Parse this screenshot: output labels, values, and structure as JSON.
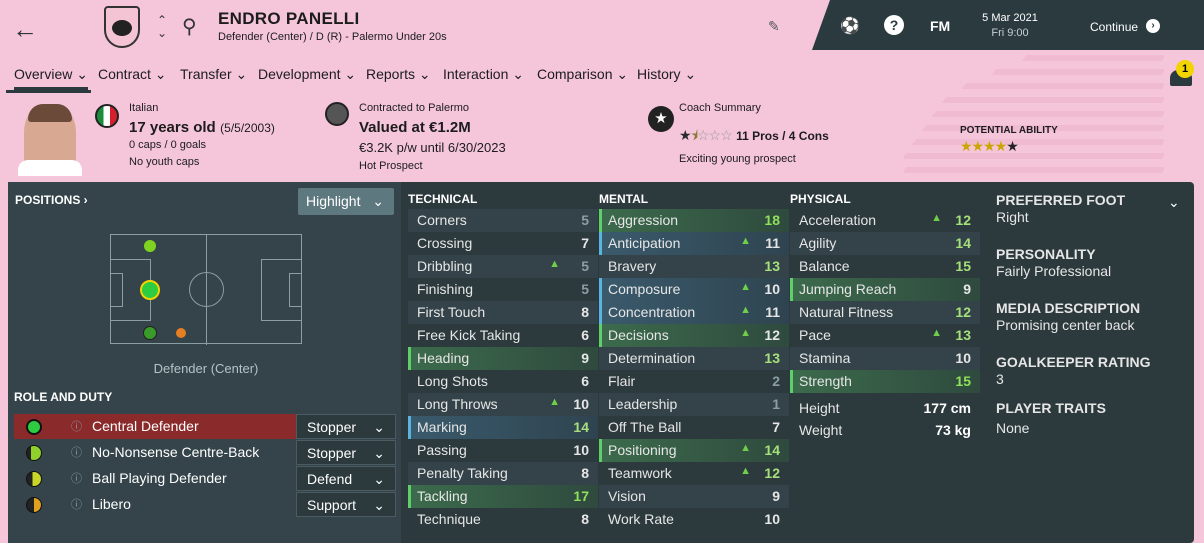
{
  "header": {
    "player_name": "ENDRO PANELLI",
    "player_sub": "Defender (Center) / D (R) - Palermo Under 20s",
    "date": "5 Mar 2021",
    "time": "Fri 9:00",
    "continue_label": "Continue",
    "fm_label": "FM",
    "notification_count": "1"
  },
  "tabs": [
    "Overview",
    "Contract",
    "Transfer",
    "Development",
    "Reports",
    "Interaction",
    "Comparison",
    "History"
  ],
  "bio": {
    "nationality": "Italian",
    "age": "17 years old",
    "dob": "(5/5/2003)",
    "caps": "0 caps / 0 goals",
    "youth_caps": "No youth caps",
    "contracted": "Contracted to Palermo",
    "value": "Valued at €1.2M",
    "wage": "€3.2K p/w until 6/30/2023",
    "status": "Hot Prospect",
    "coach_title": "Coach Summary",
    "pros_cons": "11 Pros / 4 Cons",
    "coach_note": "Exciting young prospect",
    "potential_label": "POTENTIAL ABILITY",
    "current_stars": 1.5,
    "potential_stars": 4.5
  },
  "positions": {
    "label": "POSITIONS",
    "highlight_label": "Highlight",
    "position_name": "Defender (Center)"
  },
  "roles": {
    "label": "ROLE AND DUTY",
    "items": [
      {
        "name": "Central Defender",
        "duty": "Stopper"
      },
      {
        "name": "No-Nonsense Centre-Back",
        "duty": "Stopper"
      },
      {
        "name": "Ball Playing Defender",
        "duty": "Defend"
      },
      {
        "name": "Libero",
        "duty": "Support"
      }
    ]
  },
  "technical": {
    "label": "TECHNICAL",
    "items": [
      {
        "name": "Corners",
        "value": "5"
      },
      {
        "name": "Crossing",
        "value": "7"
      },
      {
        "name": "Dribbling",
        "value": "5"
      },
      {
        "name": "Finishing",
        "value": "5"
      },
      {
        "name": "First Touch",
        "value": "8"
      },
      {
        "name": "Free Kick Taking",
        "value": "6"
      },
      {
        "name": "Heading",
        "value": "9"
      },
      {
        "name": "Long Shots",
        "value": "6"
      },
      {
        "name": "Long Throws",
        "value": "10"
      },
      {
        "name": "Marking",
        "value": "14"
      },
      {
        "name": "Passing",
        "value": "10"
      },
      {
        "name": "Penalty Taking",
        "value": "8"
      },
      {
        "name": "Tackling",
        "value": "17"
      },
      {
        "name": "Technique",
        "value": "8"
      }
    ]
  },
  "mental": {
    "label": "MENTAL",
    "items": [
      {
        "name": "Aggression",
        "value": "18"
      },
      {
        "name": "Anticipation",
        "value": "11"
      },
      {
        "name": "Bravery",
        "value": "13"
      },
      {
        "name": "Composure",
        "value": "10"
      },
      {
        "name": "Concentration",
        "value": "11"
      },
      {
        "name": "Decisions",
        "value": "12"
      },
      {
        "name": "Determination",
        "value": "13"
      },
      {
        "name": "Flair",
        "value": "2"
      },
      {
        "name": "Leadership",
        "value": "1"
      },
      {
        "name": "Off The Ball",
        "value": "7"
      },
      {
        "name": "Positioning",
        "value": "14"
      },
      {
        "name": "Teamwork",
        "value": "12"
      },
      {
        "name": "Vision",
        "value": "9"
      },
      {
        "name": "Work Rate",
        "value": "10"
      }
    ]
  },
  "physical": {
    "label": "PHYSICAL",
    "items": [
      {
        "name": "Acceleration",
        "value": "12"
      },
      {
        "name": "Agility",
        "value": "14"
      },
      {
        "name": "Balance",
        "value": "15"
      },
      {
        "name": "Jumping Reach",
        "value": "9"
      },
      {
        "name": "Natural Fitness",
        "value": "12"
      },
      {
        "name": "Pace",
        "value": "13"
      },
      {
        "name": "Stamina",
        "value": "10"
      },
      {
        "name": "Strength",
        "value": "15"
      }
    ],
    "height_label": "Height",
    "height": "177 cm",
    "weight_label": "Weight",
    "weight": "73 kg"
  },
  "details": {
    "foot_label": "PREFERRED FOOT",
    "foot": "Right",
    "personality_label": "PERSONALITY",
    "personality": "Fairly Professional",
    "media_label": "MEDIA DESCRIPTION",
    "media": "Promising center back",
    "gk_label": "GOALKEEPER RATING",
    "gk": "3",
    "traits_label": "PLAYER TRAITS",
    "traits": "None"
  }
}
